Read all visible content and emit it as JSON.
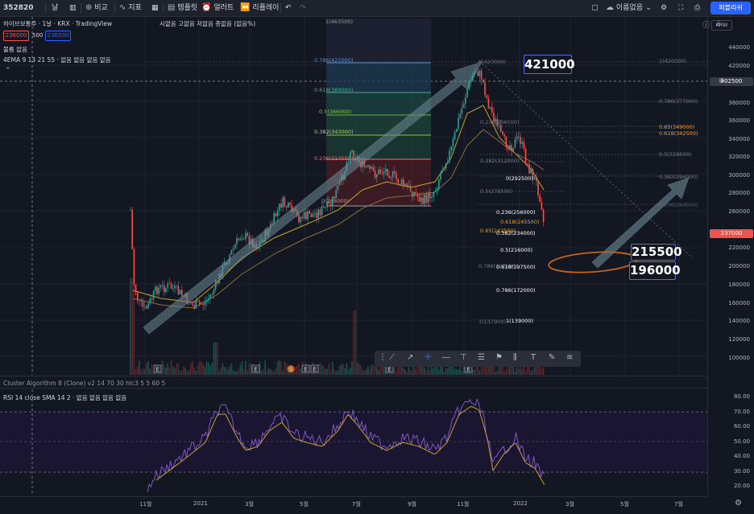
{
  "toolbar": {
    "symbol": "352820",
    "interval": "날",
    "compare": "비교",
    "indicators": "지표",
    "templates": "템플릿",
    "alert": "얼러트",
    "replay": "리플레이",
    "layout_name": "이름없음",
    "publish": "퍼블리쉬"
  },
  "legend": {
    "title": "하이브보통주 · 1날 · KRX · TradingView",
    "ohlc": "시없음 고없음 저없음 종없음 (없음%)",
    "bid": "236000",
    "spread": "500",
    "ask": "236500",
    "volume": "볼륨 없음",
    "ema": "4EMA 9 13 21 55 · 없음 없음 없음 없음",
    "cluster": "Cluster Algorithm 8 (Clone) v2 14 70 30 hlc3 5 5 60 5",
    "rsi": "RSI 14 close SMA 14 2 · 없음 없음 없음 없음"
  },
  "price_axis": {
    "exchange_badge": "KRW",
    "ticks": [
      "440000",
      "420000",
      "380000",
      "360000",
      "340000",
      "320000",
      "300000",
      "280000",
      "260000",
      "240000",
      "220000",
      "200000",
      "180000",
      "160000",
      "140000",
      "120000",
      "100000"
    ],
    "highlight_price": "402500",
    "last_price": "237000",
    "rsi_ticks": [
      "80.00",
      "70.00",
      "60.00",
      "50.00",
      "40.00",
      "30.00",
      "20.00"
    ]
  },
  "time_axis": {
    "ticks": [
      "11월",
      "2021",
      "3월",
      "5월",
      "7월",
      "9월",
      "11월",
      "2022",
      "3월",
      "5월",
      "7월"
    ]
  },
  "fib_left": {
    "top": "1(463500)",
    "levels": [
      "0.786(422000)",
      "0.618(389000)",
      "0.5(366000)",
      "0.382(343000)",
      "0.236(314500)",
      "0(268000)"
    ]
  },
  "fib_right": {
    "levels": [
      "0(420000)",
      "1(420500)",
      "0.786(377000)",
      "0.65(349000)",
      "0.618(342500)",
      "0.5(318500)",
      "0.382(294000)",
      "0.236(264500)",
      "0.5(278500)",
      "0.382(312000)",
      "0.236(336500)"
    ]
  },
  "fib_down": {
    "levels": [
      "0(292500)",
      "0.236(256000)",
      "0.618(245500)",
      "0.65(242500)",
      "0.382(234000)",
      "0.5(216000)",
      "0.786(197500)",
      "0.618(197500)",
      "0.786(172000)",
      "1(137900)",
      "1(139000)"
    ]
  },
  "callouts": {
    "top": "421000",
    "target1": "215500",
    "target2": "196000"
  },
  "colors": {
    "background": "#131722",
    "up": "#26a69a",
    "down": "#ef5350",
    "accent": "#2962ff",
    "rsi_line": "#7e57c2",
    "rsi_sma": "#c9a227",
    "callout_border": "#5b6cd8",
    "ellipse": "#c0651a"
  },
  "draw_toolbar": {
    "icons": [
      "trend-line-icon",
      "ray-icon",
      "crosshair-icon",
      "horizontal-line-icon",
      "price-label-icon",
      "fib-icon",
      "flag-icon",
      "long-short-icon",
      "text-icon",
      "brush-icon",
      "projection-icon"
    ]
  },
  "bottom_icon": "settings-gear-icon"
}
